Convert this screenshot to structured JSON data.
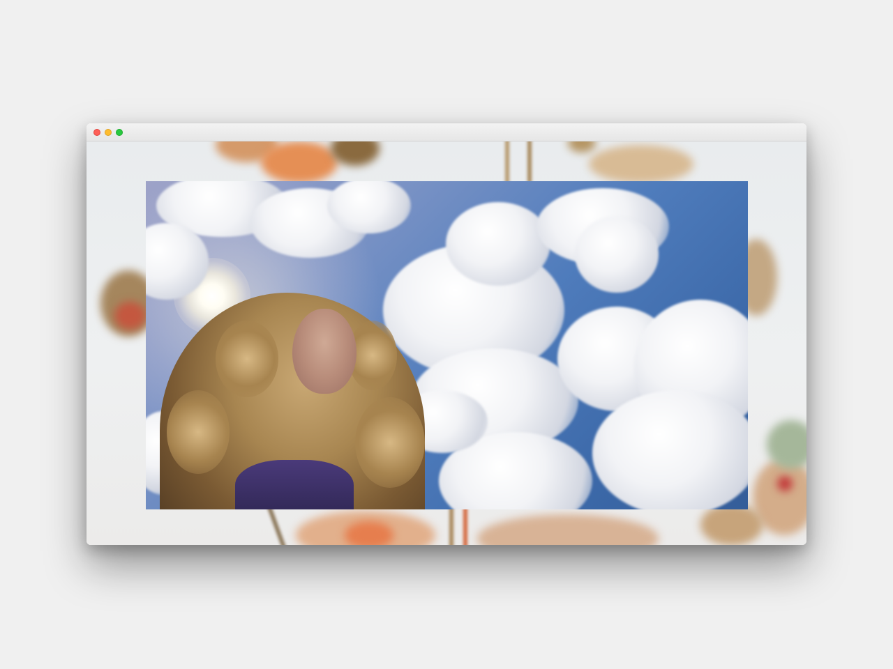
{
  "window": {
    "traffic_lights": {
      "close_color": "#fe5f57",
      "minimize_color": "#febc2e",
      "maximize_color": "#28c840"
    }
  },
  "content": {
    "background_image": "blurred-flowers-against-sky",
    "hero_image": "woman-with-curly-hair-under-cloudy-sky"
  }
}
